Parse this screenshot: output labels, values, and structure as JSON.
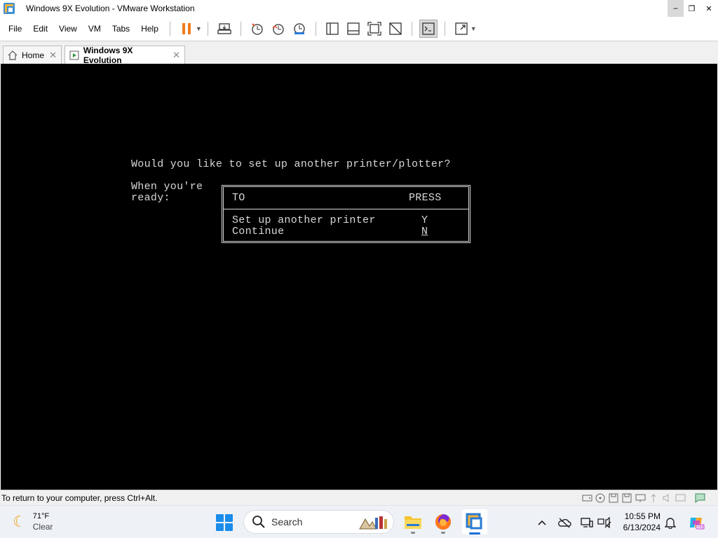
{
  "window": {
    "title": "Windows 9X Evolution - VMware Workstation",
    "minimize": "–",
    "maximize": "❐",
    "close": "✕"
  },
  "menu": [
    "File",
    "Edit",
    "View",
    "VM",
    "Tabs",
    "Help"
  ],
  "tabs": [
    {
      "label": "Home",
      "close": "✕"
    },
    {
      "label": "Windows 9X Evolution",
      "close": "✕"
    }
  ],
  "vm_screen": {
    "question": "Would you like to set up another printer/plotter?",
    "prompt_line1": "When you're",
    "prompt_line2": "ready:",
    "table_header_to": "TO",
    "table_header_press": "PRESS",
    "option1_label": "Set up another printer",
    "option1_key": "Y",
    "option2_label": "Continue",
    "option2_key": "N"
  },
  "statusbar": {
    "text": "To return to your computer, press Ctrl+Alt."
  },
  "taskbar": {
    "weather_temp": "71°F",
    "weather_condition": "Clear",
    "search_placeholder": "Search",
    "clock_time": "10:55 PM",
    "clock_date": "6/13/2024"
  },
  "colors": {
    "accent": "#1a8cea",
    "pause": "#f07c1e",
    "vm_background": "#000000",
    "vm_text": "#d8d8d8"
  }
}
